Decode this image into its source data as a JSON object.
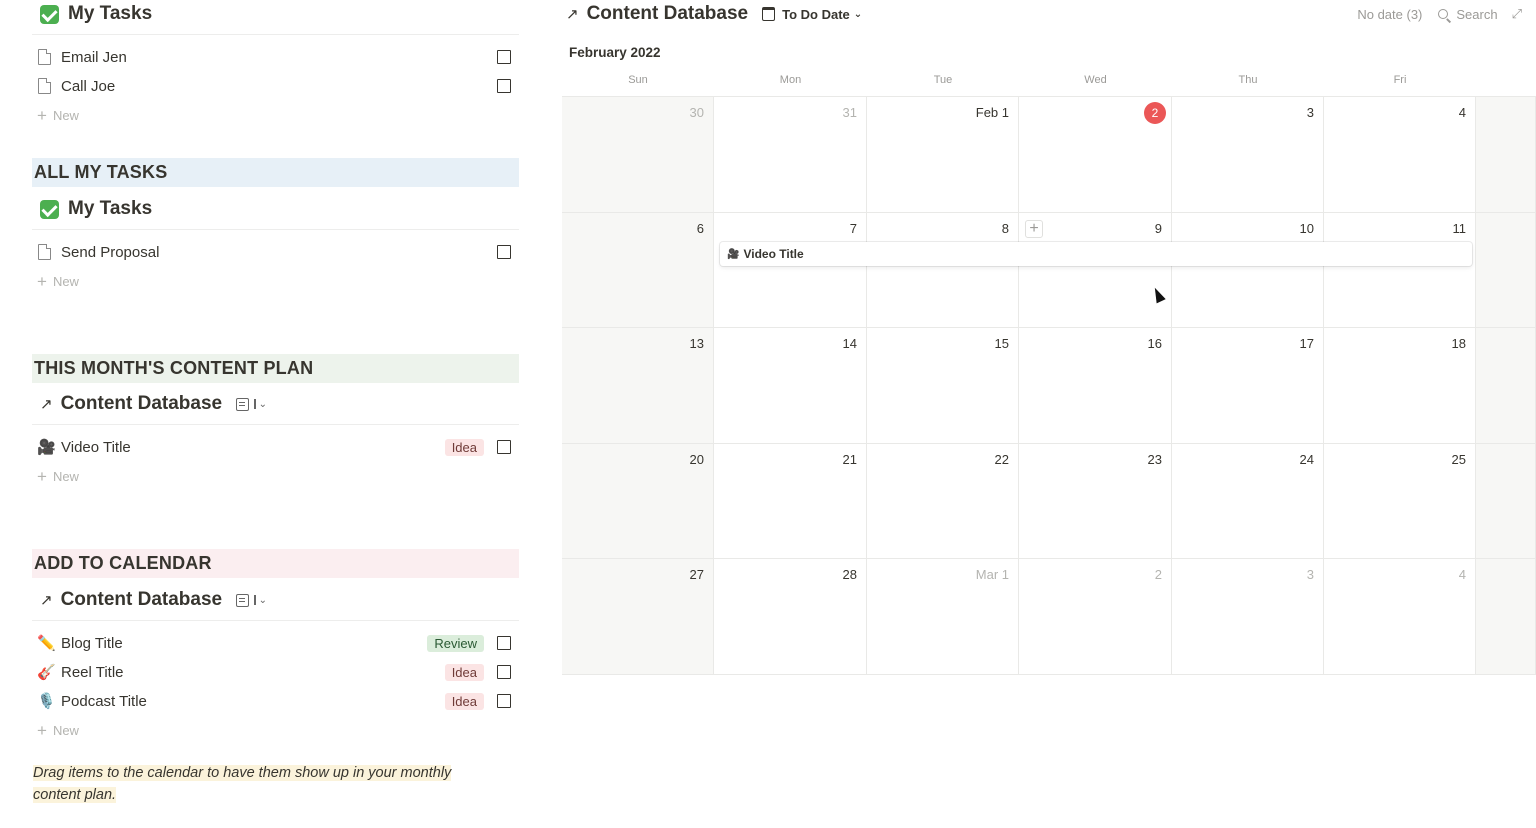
{
  "sections": {
    "my_tasks_1": {
      "title": "My Tasks",
      "rows": [
        {
          "label": "Email Jen"
        },
        {
          "label": "Call Joe"
        }
      ],
      "new_label": "New"
    },
    "all_my_tasks": {
      "header": "ALL MY TASKS",
      "header_bg": "#e7f0f7",
      "view_title": "My Tasks",
      "rows": [
        {
          "label": "Send Proposal"
        }
      ],
      "new_label": "New"
    },
    "content_plan": {
      "header": "THIS MONTH'S CONTENT PLAN",
      "header_bg": "#edf3ec",
      "view_title": "Content Database",
      "view_short": "I",
      "rows": [
        {
          "icon": "🎥",
          "label": "Video Title",
          "tag": "Idea"
        }
      ],
      "new_label": "New"
    },
    "add_to_calendar": {
      "header": "ADD TO CALENDAR",
      "header_bg": "#fbeef0",
      "view_title": "Content Database",
      "view_short": "I",
      "rows": [
        {
          "icon": "✏️",
          "label": "Blog Title",
          "tag": "Review"
        },
        {
          "icon": "🎸",
          "label": "Reel Title",
          "tag": "Idea"
        },
        {
          "icon": "🎙️",
          "label": "Podcast Title",
          "tag": "Idea"
        }
      ],
      "new_label": "New"
    },
    "note": "Drag items to the calendar to have them show up in your monthly content plan."
  },
  "calendar": {
    "title": "Content Database",
    "view": "To Do Date",
    "no_date": "No date (3)",
    "search_label": "Search",
    "month": "February 2022",
    "weekdays": [
      "Sun",
      "Mon",
      "Tue",
      "Wed",
      "Thu",
      "Fri"
    ],
    "weeks": [
      [
        "30",
        "31",
        "Feb 1",
        "2",
        "3",
        "4"
      ],
      [
        "6",
        "7",
        "8",
        "9",
        "10",
        "11"
      ],
      [
        "13",
        "14",
        "15",
        "16",
        "17",
        "18"
      ],
      [
        "20",
        "21",
        "22",
        "23",
        "24",
        "25"
      ],
      [
        "27",
        "28",
        "Mar 1",
        "2",
        "3",
        "4"
      ]
    ],
    "today_label": "2",
    "event": {
      "icon": "🎥",
      "label": "Video Title"
    },
    "colors": {
      "today": "#eb5757",
      "weekend_bg": "#f7f7f5"
    }
  }
}
